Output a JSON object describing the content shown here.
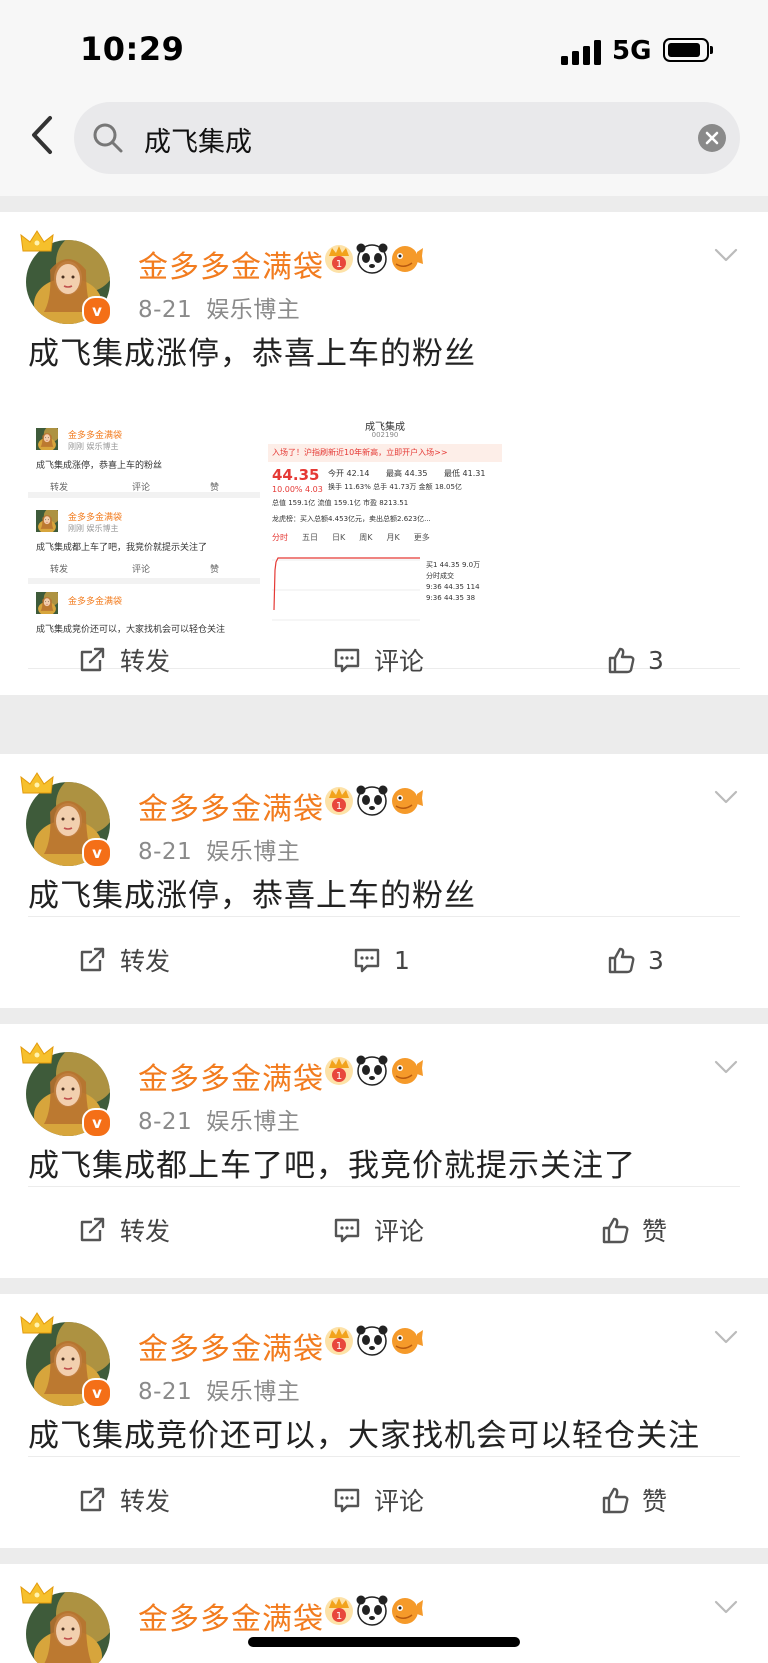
{
  "status": {
    "time": "10:29",
    "network": "5G"
  },
  "search": {
    "query": "成飞集成"
  },
  "thumb_text": {
    "image1_lines": [
      "金多多金满袋",
      "刚刚 娱乐博主",
      "成飞集成涨停，恭喜上车的粉丝",
      "转发",
      "评论",
      "赞",
      "金多多金满袋",
      "刚刚 娱乐博主",
      "成飞集成都上车了吧，我竞价就提示关注了",
      "转发",
      "评论",
      "赞",
      "金多多金满袋",
      "成飞集成竞价还可以，大家找机会可以轻仓关注"
    ],
    "image2_title": "成飞集成",
    "image2_code": "002190",
    "image2_banner": "入场了！沪指刷新近10年新高，立即开户入场>>",
    "image2_price": "44.35",
    "image2_change": "10.00%  4.03",
    "image2_open": "今开 42.14",
    "image2_high": "最高 44.35",
    "image2_low": "最低 41.31",
    "image2_row2": "换手 11.63%  总手 41.73万  金额 18.05亿",
    "image2_row3": "总值 159.1亿  流值 159.1亿  市盈 8213.51",
    "image2_dragon": "龙虎榜：买入总额4.453亿元，卖出总额2.623亿...",
    "image2_tabs": [
      "分时",
      "五日",
      "日K",
      "周K",
      "月K",
      "更多"
    ],
    "image2_book": [
      "买1 44.35 9.0万",
      "分时成交",
      "9:36 44.35 114",
      "9:36 44.35 38"
    ]
  },
  "posts": [
    {
      "author": "金多多金满袋",
      "date": "8-21",
      "tag": "娱乐博主",
      "text": "成飞集成涨停，恭喜上车的粉丝",
      "repost": "转发",
      "comment": "评论",
      "like": "3",
      "has_images": true
    },
    {
      "author": "金多多金满袋",
      "date": "8-21",
      "tag": "娱乐博主",
      "text": "成飞集成涨停，恭喜上车的粉丝",
      "repost": "转发",
      "comment": "1",
      "like": "3"
    },
    {
      "author": "金多多金满袋",
      "date": "8-21",
      "tag": "娱乐博主",
      "text": "成飞集成都上车了吧，我竞价就提示关注了",
      "repost": "转发",
      "comment": "评论",
      "like": "赞"
    },
    {
      "author": "金多多金满袋",
      "date": "8-21",
      "tag": "娱乐博主",
      "text": "成飞集成竞价还可以，大家找机会可以轻仓关注",
      "repost": "转发",
      "comment": "评论",
      "like": "赞"
    },
    {
      "author": "金多多金满袋"
    }
  ],
  "colors": {
    "author": "#f27c1f",
    "verified": "#f46f17",
    "up": "#e53935"
  }
}
